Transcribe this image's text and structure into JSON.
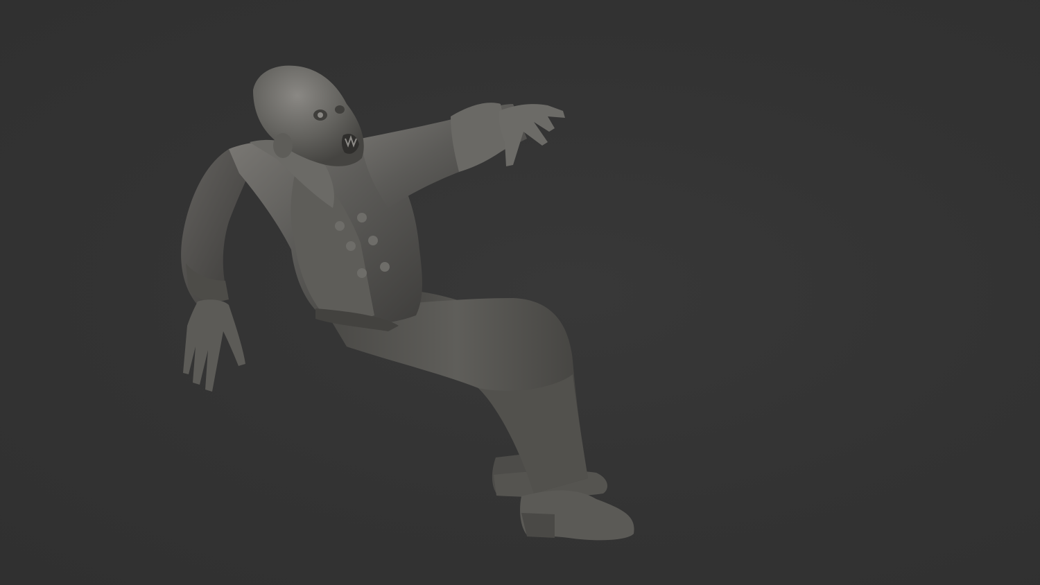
{
  "scene": {
    "background_color": "#333333",
    "model_base_color": "#5a5956",
    "model_highlight_color": "#7a7874",
    "model_shadow_color": "#3c3b39",
    "subject": "sculpted-zombie-figure"
  }
}
